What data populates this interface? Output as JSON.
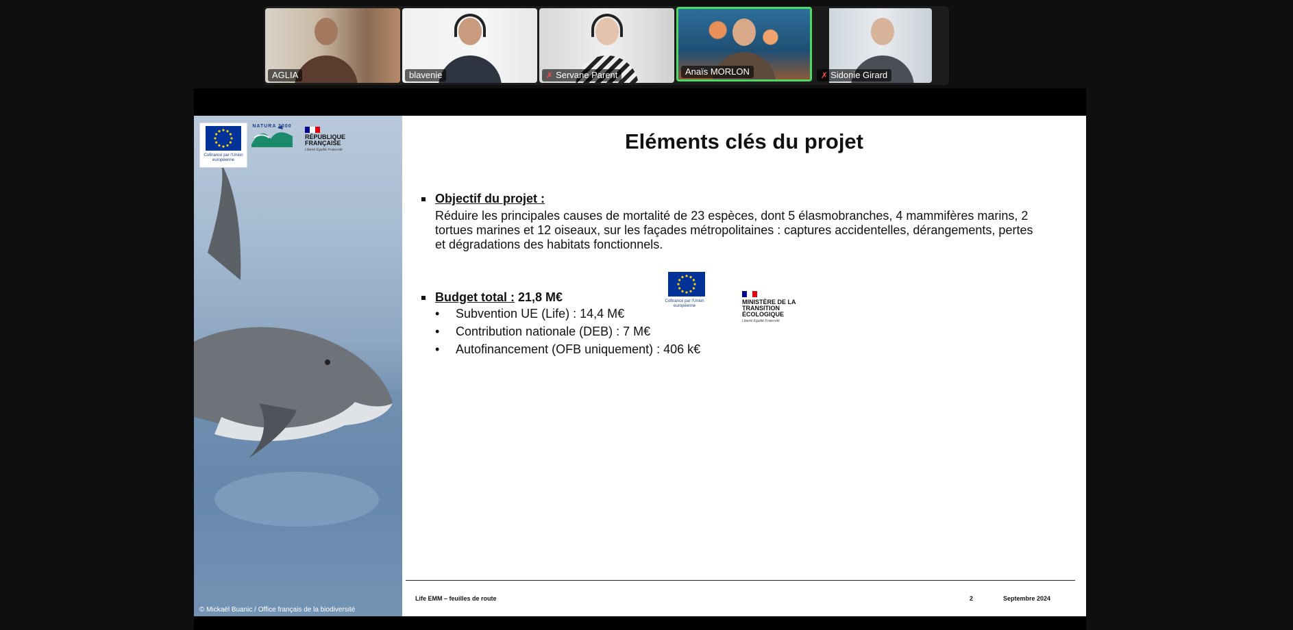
{
  "participants": [
    {
      "name": "AGLIA",
      "muted": false,
      "active": false
    },
    {
      "name": "blavenie",
      "muted": false,
      "active": false
    },
    {
      "name": "Servane Parent",
      "muted": true,
      "active": false
    },
    {
      "name": "Anaïs MORLON",
      "muted": false,
      "active": true
    },
    {
      "name": "Sidonie Girard",
      "muted": true,
      "active": false
    }
  ],
  "icons": {
    "muted_mic": "microphone-off-icon"
  },
  "colors": {
    "active_speaker_border": "#4cd964",
    "eu_blue": "#003399",
    "eu_star": "#ffcc00"
  },
  "slide": {
    "title": "Eléments clés du projet",
    "objective": {
      "heading": "Objectif du projet :",
      "text": "Réduire les principales causes de mortalité de 23 espèces, dont 5 élasmobranches, 4 mammifères marins, 2 tortues marines et 12 oiseaux, sur les façades métropolitaines : captures accidentelles, dérangements, pertes et dégradations des habitats fonctionnels."
    },
    "budget": {
      "heading": "Budget total :",
      "total": "21,8 M€",
      "items": [
        "Subvention UE (Life) : 14,4 M€",
        "Contribution nationale (DEB) : 7 M€",
        "Autofinancement (OFB uniquement) :  406 k€"
      ]
    },
    "logos": {
      "eu_caption": "Cofinancé par l'Union européenne",
      "natura": "NATURA 2000",
      "rf_name": "RÉPUBLIQUE FRANÇAISE",
      "rf_motto": "Liberté Égalité Fraternité",
      "ministry_name": "MINISTÈRE DE LA TRANSITION ÉCOLOGIQUE",
      "ministry_motto": "Liberté Égalité Fraternité"
    },
    "photo_credit": "© Mickaël Buanic / Office français de la biodiversité",
    "footer": {
      "left": "Life EMM – feuilles de route",
      "page": "2",
      "date": "Septembre 2024"
    }
  }
}
